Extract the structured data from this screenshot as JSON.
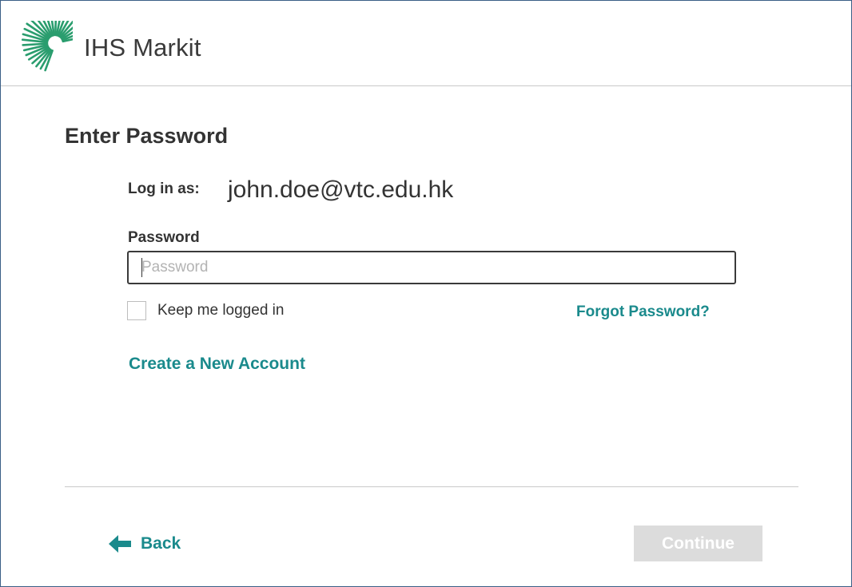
{
  "header": {
    "brand_name": "IHS Markit",
    "logo_icon": "ihs-markit-sunburst-logo",
    "logo_color": "#2a9d6e"
  },
  "main": {
    "title": "Enter Password",
    "login_as": {
      "label": "Log in as:",
      "value": "john.doe@vtc.edu.hk"
    },
    "password": {
      "label": "Password",
      "placeholder": "Password",
      "value": ""
    },
    "keep_logged_in": {
      "label": "Keep me logged in",
      "checked": false
    },
    "forgot_password_label": "Forgot Password?",
    "create_account_label": "Create a New Account"
  },
  "footer": {
    "back_label": "Back",
    "back_icon": "arrow-left-icon",
    "continue_label": "Continue",
    "continue_enabled": false
  },
  "colors": {
    "accent": "#1a8a8c",
    "text": "#333333",
    "disabled_button": "#dcdcdc",
    "frame_border": "#3b5f86"
  }
}
